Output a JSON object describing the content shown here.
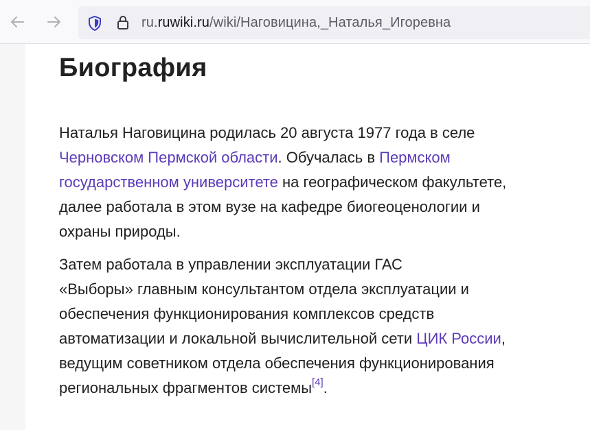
{
  "browser": {
    "url_prefix": "ru.",
    "url_domain": "ruwiki.ru",
    "url_path": "/wiki/Наговицина,_Наталья_Игоревна"
  },
  "article": {
    "heading": "Биография",
    "p1": {
      "line1": "Наталья Наговицина родилась 20 августа 1977 года в селе",
      "link1": "Черновском Пермской области",
      "text2": ". Обучалась в ",
      "link2a": "Пермском",
      "link2b": "государственном университете",
      "text3": " на географическом факультете,",
      "line4": "далее работала в этом вузе на кафедре биогеоценологии и",
      "line5": "охраны природы."
    },
    "p2": {
      "line1": "Затем работала в управлении эксплуатации ГАС",
      "line2": "«Выборы» главным консультантом отдела эксплуатации и",
      "line3": "обеспечения функционирования комплексов средств",
      "line4_text": "автоматизации и локальной вычислительной сети ",
      "link": "ЦИК России",
      "line4_end": ",",
      "line5": "ведущим советником отдела обеспечения функционирования",
      "line6_text": "региональных фрагментов системы",
      "ref": "[4]",
      "line6_end": "."
    }
  }
}
